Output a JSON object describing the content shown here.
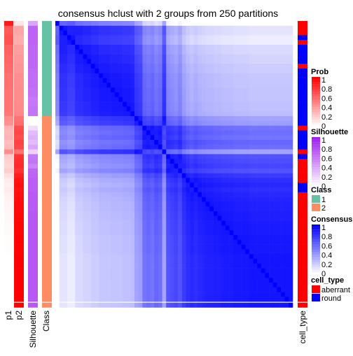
{
  "chart_data": {
    "type": "heatmap",
    "title": "consensus hclust with 2 groups from 250 partitions",
    "annotation_labels": [
      "p1",
      "p2",
      "Silhouette",
      "Class",
      "cell_type"
    ],
    "p1": [
      0.9,
      0.65,
      0.65,
      0.68,
      0.68,
      0.62,
      0.62,
      0.6,
      0.6,
      0.58,
      0.58,
      0.56,
      0.56,
      0.56,
      0.55,
      0.55,
      0.55,
      0.54,
      0.54,
      0.53,
      0.45,
      0.43,
      0.3,
      0.28,
      0.3,
      0.26,
      0.28,
      0.45,
      0.2,
      0.18,
      0.16,
      0.2,
      0.12,
      0.08,
      0.06,
      0.08,
      0.06,
      0.05,
      0.04,
      0.04,
      0.03,
      0.03,
      0.02,
      0.02,
      0.02,
      0.01,
      0.01,
      0.01,
      0.01,
      0.0,
      0.0,
      0.0,
      0.0,
      0.0,
      0.0,
      0.0,
      0.0,
      0.0,
      0.0,
      0.0
    ],
    "silhouette": [
      0.4,
      0.7,
      0.7,
      0.7,
      0.7,
      0.68,
      0.68,
      0.68,
      0.68,
      0.68,
      0.66,
      0.66,
      0.66,
      0.66,
      0.64,
      0.64,
      0.6,
      0.6,
      0.62,
      0.62,
      0.0,
      0.0,
      0.15,
      0.3,
      0.35,
      0.3,
      0.4,
      0.2,
      0.6,
      0.62,
      0.55,
      0.68,
      0.7,
      0.72,
      0.72,
      0.72,
      0.74,
      0.74,
      0.74,
      0.74,
      0.75,
      0.75,
      0.75,
      0.75,
      0.75,
      0.75,
      0.75,
      0.75,
      0.75,
      0.75,
      0.75,
      0.75,
      0.75,
      0.75,
      0.75,
      0.75,
      0.75,
      0.75,
      0.75,
      0.75
    ],
    "class": [
      1,
      1,
      1,
      1,
      1,
      1,
      1,
      1,
      1,
      1,
      1,
      1,
      1,
      1,
      1,
      1,
      1,
      1,
      1,
      1,
      2,
      2,
      2,
      2,
      2,
      2,
      2,
      2,
      2,
      2,
      2,
      2,
      2,
      2,
      2,
      2,
      2,
      2,
      2,
      2,
      2,
      2,
      2,
      2,
      2,
      2,
      2,
      2,
      2,
      2,
      2,
      2,
      2,
      2,
      2,
      2,
      2,
      2,
      2,
      2
    ],
    "cell_type": [
      "aberrant",
      "aberrant",
      "aberrant",
      "round",
      "aberrant",
      "round",
      "round",
      "round",
      "round",
      "aberrant",
      "round",
      "round",
      "round",
      "round",
      "round",
      "round",
      "round",
      "round",
      "round",
      "round",
      "round",
      "round",
      "aberrant",
      "round",
      "round",
      "round",
      "round",
      "aberrant",
      "round",
      "aberrant",
      "aberrant",
      "aberrant",
      "aberrant",
      "aberrant",
      "round",
      "round",
      "aberrant",
      "aberrant",
      "aberrant",
      "aberrant",
      "aberrant",
      "aberrant",
      "aberrant",
      "aberrant",
      "aberrant",
      "aberrant",
      "aberrant",
      "aberrant",
      "aberrant",
      "aberrant",
      "aberrant",
      "aberrant",
      "aberrant",
      "aberrant",
      "aberrant",
      "aberrant",
      "aberrant",
      "aberrant",
      "aberrant",
      "aberrant"
    ],
    "color_scales": {
      "prob": {
        "low": "#ffffff",
        "high": "#ff0000"
      },
      "silhouette": {
        "low": "#ffffff",
        "high": "#a020f0"
      },
      "consensus": {
        "low": "#ffffff",
        "high": "#0000ff"
      },
      "class": {
        "1": "#66c2a5",
        "2": "#fc8d62"
      },
      "cell_type": {
        "aberrant": "#ff0000",
        "round": "#0000ff"
      }
    },
    "legends": [
      {
        "title": "Prob",
        "type": "continuous",
        "ticks": [
          "1",
          "0.8",
          "0.6",
          "0.4",
          "0.2",
          "0"
        ]
      },
      {
        "title": "Silhouette",
        "type": "continuous",
        "ticks": [
          "1",
          "0.8",
          "0.6",
          "0.4",
          "0.2",
          "0"
        ]
      },
      {
        "title": "Class",
        "type": "discrete",
        "items": [
          "1",
          "2"
        ]
      },
      {
        "title": "Consensus",
        "type": "continuous",
        "ticks": [
          "1",
          "0.8",
          "0.6",
          "0.4",
          "0.2",
          "0"
        ]
      },
      {
        "title": "cell_type",
        "type": "discrete",
        "items": [
          "aberrant",
          "round"
        ]
      }
    ]
  }
}
